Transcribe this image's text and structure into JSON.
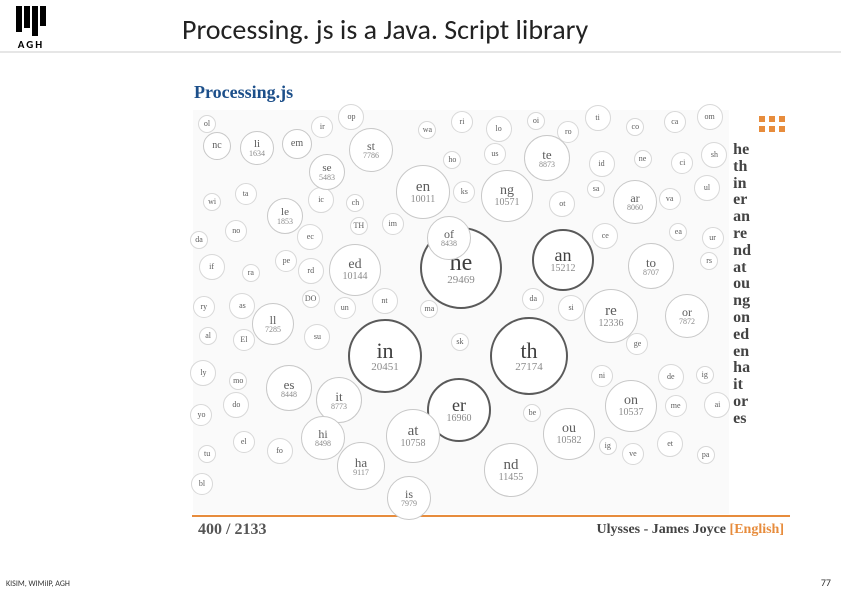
{
  "header": {
    "logo_text": "AGH",
    "title": "Processing. js is a Java. Script library"
  },
  "figure": {
    "title": "Processing.js"
  },
  "chart_data": {
    "type": "bubble",
    "main_bigrams": [
      {
        "bigram": "he",
        "count": 29469,
        "highlight": true,
        "size": "xl"
      },
      {
        "bigram": "th",
        "count": 27174,
        "highlight": true,
        "size": "xl"
      },
      {
        "bigram": "in",
        "count": 20451,
        "highlight": true,
        "size": "xl"
      },
      {
        "bigram": "er",
        "count": 16960,
        "highlight": true,
        "size": "lg"
      },
      {
        "bigram": "an",
        "count": 15212,
        "highlight": true,
        "size": "lg"
      },
      {
        "bigram": "re",
        "count": 12336,
        "highlight": false,
        "size": "lg"
      },
      {
        "bigram": "nd",
        "count": 11455,
        "highlight": false,
        "size": "lg"
      },
      {
        "bigram": "en",
        "count": 10011,
        "highlight": false,
        "size": "lg"
      },
      {
        "bigram": "at",
        "count": 10758,
        "highlight": false,
        "size": "lg"
      },
      {
        "bigram": "ou",
        "count": 10582,
        "highlight": false,
        "size": "lg"
      },
      {
        "bigram": "ng",
        "count": 10571,
        "highlight": false,
        "size": "lg"
      },
      {
        "bigram": "on",
        "count": 10537,
        "highlight": false,
        "size": "lg"
      },
      {
        "bigram": "ed",
        "count": 10144,
        "highlight": false,
        "size": "lg"
      },
      {
        "bigram": "ha",
        "count": 9117,
        "highlight": false,
        "size": "md"
      },
      {
        "bigram": "to",
        "count": 8707,
        "highlight": false,
        "size": "md"
      },
      {
        "bigram": "or",
        "count": 7872,
        "highlight": false,
        "size": "md"
      },
      {
        "bigram": "of",
        "count": 8438,
        "highlight": false,
        "size": "md"
      },
      {
        "bigram": "te",
        "count": 8873,
        "highlight": false,
        "size": "md"
      },
      {
        "bigram": "es",
        "count": 8448,
        "highlight": false,
        "size": "md"
      },
      {
        "bigram": "it",
        "count": 8773,
        "highlight": false,
        "size": "md"
      },
      {
        "bigram": "ar",
        "count": 8060,
        "highlight": false,
        "size": "md"
      },
      {
        "bigram": "hi",
        "count": 8498,
        "highlight": false,
        "size": "md"
      },
      {
        "bigram": "is",
        "count": 7979,
        "highlight": false,
        "size": "md"
      },
      {
        "bigram": "st",
        "count": 7786,
        "highlight": false,
        "size": "md"
      },
      {
        "bigram": "ll",
        "count": 7285,
        "highlight": false,
        "size": "md"
      },
      {
        "bigram": "le",
        "count": 1853,
        "highlight": false,
        "size": "sm"
      },
      {
        "bigram": "li",
        "count": 1634,
        "highlight": false,
        "size": "sm"
      },
      {
        "bigram": "se",
        "count": 5483,
        "highlight": false,
        "size": "sm"
      },
      {
        "bigram": "nc",
        "count": 0,
        "highlight": false,
        "size": "xs"
      },
      {
        "bigram": "em",
        "count": 0,
        "highlight": false,
        "size": "xs"
      }
    ],
    "sidebar_bigrams": [
      "he",
      "th",
      "in",
      "er",
      "an",
      "re",
      "nd",
      "at",
      "ou",
      "ng",
      "on",
      "ed",
      "en",
      "ha",
      "it",
      "or",
      "es"
    ]
  },
  "status": {
    "progress_current": 400,
    "progress_total": 2133,
    "source_title": "Ulysses - James Joyce",
    "source_lang": "[English]"
  },
  "footer": {
    "left": "KISIM, WIMiIP, AGH",
    "page_number": "77"
  }
}
